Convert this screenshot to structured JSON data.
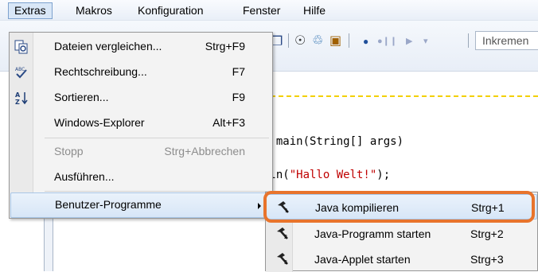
{
  "menubar": {
    "items": [
      {
        "label": "Extras"
      },
      {
        "label": "Makros"
      },
      {
        "label": "Konfiguration"
      },
      {
        "label": "Fenster"
      },
      {
        "label": "Hilfe"
      }
    ]
  },
  "toolbar": {
    "search_text": "Inkremen"
  },
  "editor": {
    "code_lines": {
      "line1": "d main(String[] args)",
      "line2_prefix": "tln(",
      "line2_string": "\"Hallo Welt!\"",
      "line2_suffix": ");"
    }
  },
  "extras_menu": {
    "items": [
      {
        "label": "Dateien vergleichen...",
        "shortcut": "Strg+F9",
        "icon": "compare-files-icon"
      },
      {
        "label": "Rechtschreibung...",
        "shortcut": "F7",
        "icon": "spellcheck-icon"
      },
      {
        "label": "Sortieren...",
        "shortcut": "F9",
        "icon": "sort-icon"
      },
      {
        "label": "Windows-Explorer",
        "shortcut": "Alt+F3"
      },
      {
        "label": "Stopp",
        "shortcut": "Strg+Abbrechen",
        "disabled": true
      },
      {
        "label": "Ausführen...",
        "shortcut": ""
      },
      {
        "label": "Benutzer-Programme",
        "shortcut": "",
        "submenu": true
      }
    ]
  },
  "submenu": {
    "items": [
      {
        "label": "Java kompilieren",
        "shortcut": "Strg+1",
        "icon": "hammer-icon",
        "num": "1"
      },
      {
        "label": "Java-Programm starten",
        "shortcut": "Strg+2",
        "icon": "hammer-icon",
        "num": "2"
      },
      {
        "label": "Java-Applet starten",
        "shortcut": "Strg+3",
        "icon": "hammer-icon",
        "num": "3"
      }
    ]
  },
  "colors": {
    "callout": "#e8742c",
    "highlight": "#d7e6f7",
    "string": "#c00000"
  }
}
